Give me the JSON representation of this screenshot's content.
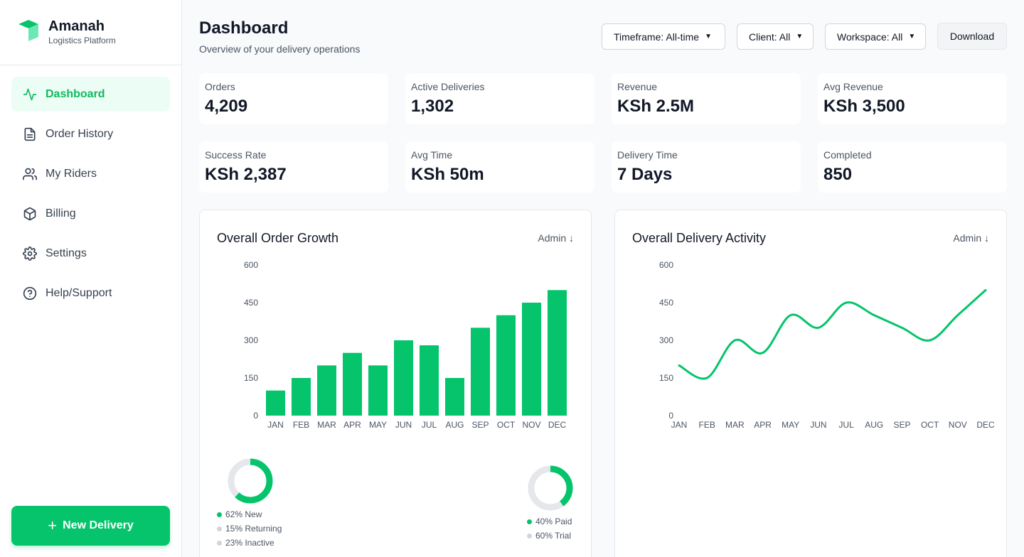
{
  "brand": {
    "name": "Amanah",
    "subtitle": "Logistics Platform"
  },
  "nav": [
    {
      "label": "Dashboard",
      "icon": "activity-icon",
      "active": true
    },
    {
      "label": "Order History",
      "icon": "file-text-icon"
    },
    {
      "label": "My Riders",
      "icon": "users-icon"
    },
    {
      "label": "Billing",
      "icon": "box-icon"
    },
    {
      "label": "Settings",
      "icon": "gear-icon"
    },
    {
      "label": "Help/Support",
      "icon": "help-circle-icon"
    }
  ],
  "new_delivery_label": "New Delivery",
  "header": {
    "title": "Dashboard",
    "subtitle": "Overview of your delivery operations"
  },
  "filters": {
    "timeframe": "Timeframe: All-time",
    "client": "Client: All",
    "workspace": "Workspace: All"
  },
  "download_label": "Download",
  "stats": [
    {
      "label": "Orders",
      "value": "4,209"
    },
    {
      "label": "Active Deliveries",
      "value": "1,302"
    },
    {
      "label": "Revenue",
      "value": "KSh 2.5M"
    },
    {
      "label": "Avg Revenue",
      "value": "KSh 3,500"
    },
    {
      "label": "Success Rate",
      "value": "KSh 2,387"
    },
    {
      "label": "Avg Time",
      "value": "KSh 50m"
    },
    {
      "label": "Delivery Time",
      "value": "7 Days"
    },
    {
      "label": "Completed",
      "value": "850"
    }
  ],
  "colors": {
    "accent": "#05c46b",
    "muted": "#e5e7eb"
  },
  "chart_data": [
    {
      "type": "bar",
      "title": "Overall Order Growth",
      "filter_label": "Admin ↓",
      "categories": [
        "JAN",
        "FEB",
        "MAR",
        "APR",
        "MAY",
        "JUN",
        "JUL",
        "AUG",
        "SEP",
        "OCT",
        "NOV",
        "DEC"
      ],
      "values": [
        100,
        150,
        200,
        250,
        200,
        300,
        280,
        150,
        350,
        400,
        450,
        500
      ],
      "ylim": [
        0,
        600
      ],
      "yticks": [
        "0",
        "150",
        "300",
        "450",
        "600"
      ],
      "grid": false
    },
    {
      "type": "line",
      "title": "Overall Delivery Activity",
      "filter_label": "Admin ↓",
      "categories": [
        "JAN",
        "FEB",
        "MAR",
        "APR",
        "MAY",
        "JUN",
        "JUL",
        "AUG",
        "SEP",
        "OCT",
        "NOV",
        "DEC"
      ],
      "values": [
        200,
        150,
        300,
        250,
        400,
        350,
        450,
        400,
        350,
        300,
        400,
        500
      ],
      "ylim": [
        0,
        600
      ],
      "yticks": [
        "0",
        "150",
        "300",
        "450",
        "600"
      ],
      "grid": false
    }
  ],
  "donuts": [
    {
      "segments": [
        {
          "label": "62% New",
          "value": 62,
          "color": "#05c46b"
        },
        {
          "label": "15% Returning",
          "value": 15,
          "color": "#e5e7eb"
        },
        {
          "label": "23% Inactive",
          "value": 23,
          "color": "#e5e7eb"
        }
      ]
    },
    {
      "segments": [
        {
          "label": "40% Paid",
          "value": 40,
          "color": "#05c46b"
        },
        {
          "label": "60% Trial",
          "value": 60,
          "color": "#e5e7eb"
        }
      ]
    }
  ]
}
